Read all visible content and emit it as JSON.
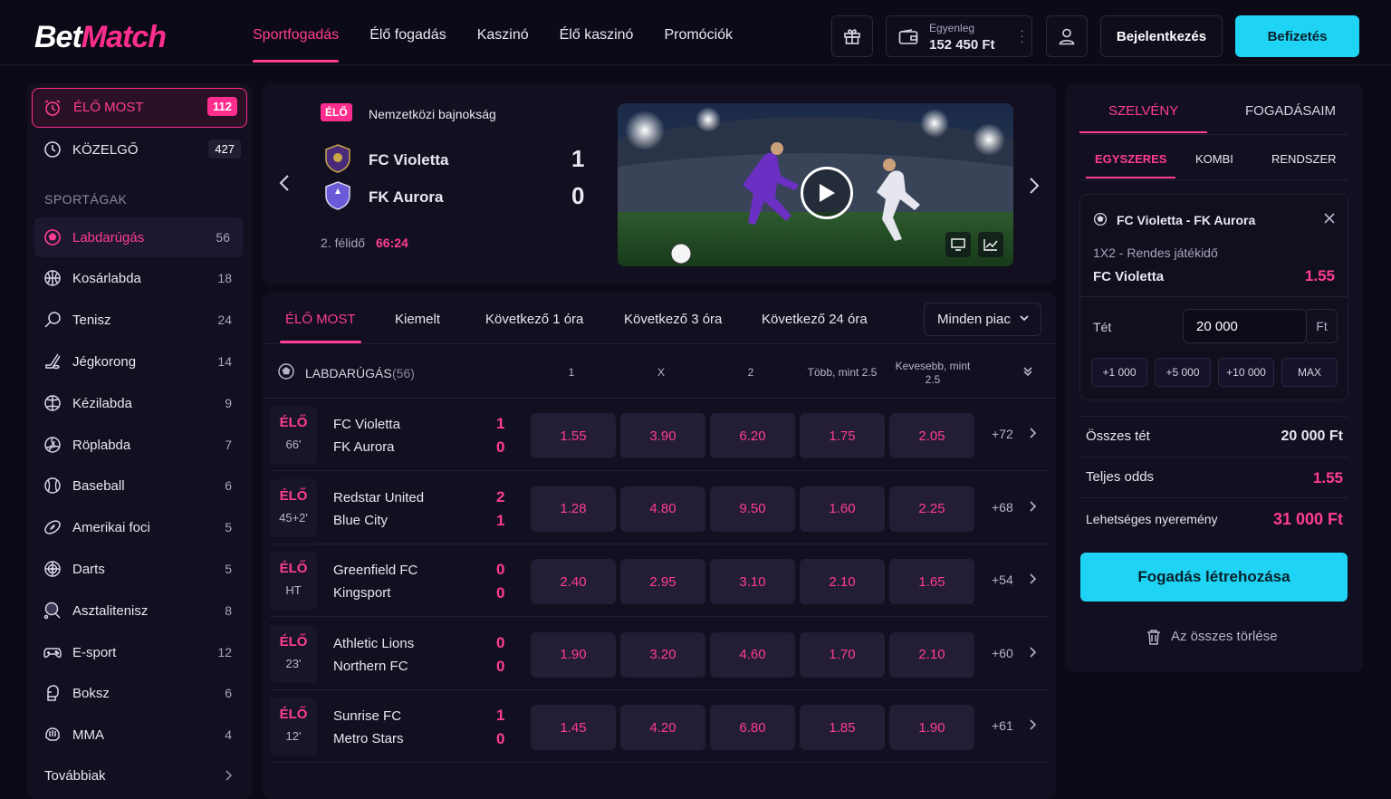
{
  "brand": {
    "part1": "Bet",
    "part2": "Match"
  },
  "nav": [
    "Sportfogadás",
    "Élő fogadás",
    "Kaszinó",
    "Élő kaszinó",
    "Promóciók"
  ],
  "account": {
    "balance_label": "Egyenleg",
    "balance_value": "152 450 Ft",
    "login": "Bejelentkezés",
    "deposit": "Befizetés"
  },
  "sidebar": {
    "live_now": {
      "label": "ÉLŐ MOST",
      "count": "112"
    },
    "upcoming": {
      "label": "KÖZELGŐ",
      "count": "427"
    },
    "section_title": "SPORTÁGAK",
    "sports": [
      {
        "label": "Labdarúgás",
        "count": "56",
        "icon": "soccer-ball-icon"
      },
      {
        "label": "Kosárlabda",
        "count": "18",
        "icon": "basketball-icon"
      },
      {
        "label": "Tenisz",
        "count": "24",
        "icon": "tennis-racket-icon"
      },
      {
        "label": "Jégkorong",
        "count": "14",
        "icon": "hockey-stick-icon"
      },
      {
        "label": "Kézilabda",
        "count": "9",
        "icon": "handball-icon"
      },
      {
        "label": "Röplabda",
        "count": "7",
        "icon": "volleyball-icon"
      },
      {
        "label": "Baseball",
        "count": "6",
        "icon": "baseball-icon"
      },
      {
        "label": "Amerikai foci",
        "count": "5",
        "icon": "american-football-icon"
      },
      {
        "label": "Darts",
        "count": "5",
        "icon": "dartboard-icon"
      },
      {
        "label": "Asztalitenisz",
        "count": "8",
        "icon": "table-tennis-icon"
      },
      {
        "label": "E-sport",
        "count": "12",
        "icon": "gamepad-icon"
      },
      {
        "label": "Boksz",
        "count": "6",
        "icon": "boxing-glove-icon"
      },
      {
        "label": "MMA",
        "count": "4",
        "icon": "mma-glove-icon"
      }
    ],
    "more": "Továbbiak"
  },
  "featured": {
    "badge": "ÉLŐ",
    "league": "Nemzetközi bajnokság",
    "home": "FC Violetta",
    "away": "FK Aurora",
    "home_score": "1",
    "away_score": "0",
    "period": "2. félidő",
    "clock": "66:24"
  },
  "tabs": [
    "ÉLŐ MOST",
    "Kiemelt",
    "Következő 1 óra",
    "Következő 3 óra",
    "Következő 24 óra"
  ],
  "market_select": "Minden piac",
  "table": {
    "sport": "LABDARÚGÁS",
    "sport_count": "(56)",
    "columns": [
      "1",
      "X",
      "2",
      "Több, mint 2.5",
      "Kevesebb, mint 2.5"
    ]
  },
  "matches": [
    {
      "live": "ÉLŐ",
      "time": "66'",
      "home": "FC Violetta",
      "away": "FK Aurora",
      "hs": "1",
      "as": "0",
      "odds": [
        "1.55",
        "3.90",
        "6.20",
        "1.75",
        "2.05"
      ],
      "more": "+72"
    },
    {
      "live": "ÉLŐ",
      "time": "45+2'",
      "home": "Redstar United",
      "away": "Blue City",
      "hs": "2",
      "as": "1",
      "odds": [
        "1.28",
        "4.80",
        "9.50",
        "1.60",
        "2.25"
      ],
      "more": "+68"
    },
    {
      "live": "ÉLŐ",
      "time": "HT",
      "home": "Greenfield FC",
      "away": "Kingsport",
      "hs": "0",
      "as": "0",
      "odds": [
        "2.40",
        "2.95",
        "3.10",
        "2.10",
        "1.65"
      ],
      "more": "+54"
    },
    {
      "live": "ÉLŐ",
      "time": "23'",
      "home": "Athletic Lions",
      "away": "Northern FC",
      "hs": "0",
      "as": "0",
      "odds": [
        "1.90",
        "3.20",
        "4.60",
        "1.70",
        "2.10"
      ],
      "more": "+60"
    },
    {
      "live": "ÉLŐ",
      "time": "12'",
      "home": "Sunrise FC",
      "away": "Metro Stars",
      "hs": "1",
      "as": "0",
      "odds": [
        "1.45",
        "4.20",
        "6.80",
        "1.85",
        "1.90"
      ],
      "more": "+61"
    }
  ],
  "slip": {
    "tabs": [
      "SZELVÉNY",
      "FOGADÁSAIM"
    ],
    "subtabs": [
      "EGYSZERES",
      "KOMBI",
      "RENDSZER"
    ],
    "event": "FC Violetta - FK Aurora",
    "market": "1X2 - Rendes játékidő",
    "selection": "FC Violetta",
    "odd": "1.55",
    "stake_label": "Tét",
    "stake_value": "20 000",
    "currency": "Ft",
    "quick": [
      "+1 000",
      "+5 000",
      "+10 000",
      "MAX"
    ],
    "total_stake_label": "Összes tét",
    "total_stake": "20 000 Ft",
    "total_odds_label": "Teljes odds",
    "total_odds": "1.55",
    "win_label": "Lehetséges nyeremény",
    "win": "31 000 Ft",
    "place": "Fogadás létrehozása",
    "clear": "Az összes törlése"
  },
  "colors": {
    "accent": "#ff2d8e",
    "cta": "#1fd3f4",
    "background": "#0c0a17",
    "panel": "#120f20"
  }
}
